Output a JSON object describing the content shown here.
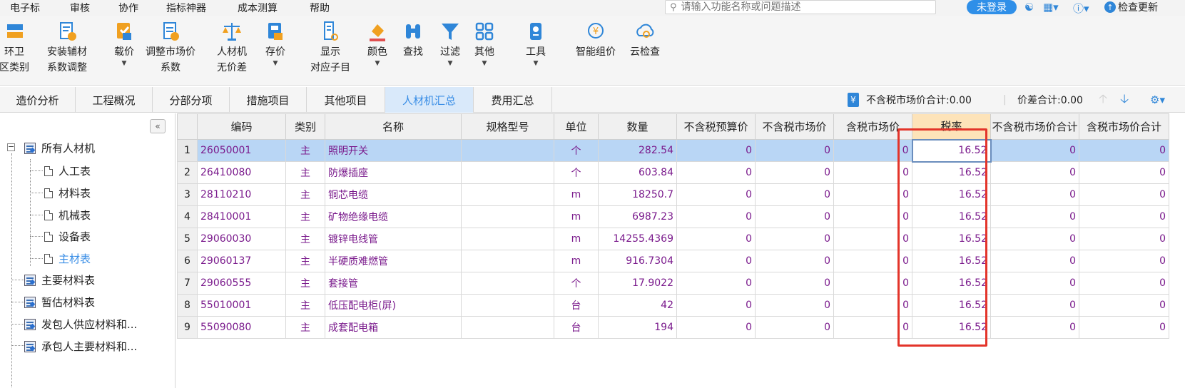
{
  "menu": [
    "电子标",
    "审核",
    "协作",
    "指标神器",
    "成本测算",
    "帮助"
  ],
  "search": {
    "placeholder": "请输入功能名称或问题描述"
  },
  "account": {
    "login_label": "未登录",
    "update_label": "检查更新"
  },
  "ribbon": [
    {
      "line1": "环卫",
      "line2": "区类别",
      "icon": "region-category-icon"
    },
    {
      "line1": "安装辅材",
      "line2": "系数调整",
      "icon": "material-coefficient-icon"
    },
    {
      "line1": "载价",
      "line2": "",
      "icon": "load-price-icon"
    },
    {
      "line1": "调整市场价",
      "line2": "系数",
      "icon": "adjust-market-price-icon"
    },
    {
      "line1": "人材机",
      "line2": "无价差",
      "icon": "balance-icon"
    },
    {
      "line1": "存价",
      "line2": "",
      "icon": "save-price-icon"
    },
    {
      "line1": "显示",
      "line2": "对应子目",
      "icon": "show-subitem-icon"
    },
    {
      "line1": "颜色",
      "line2": "",
      "icon": "color-bucket-icon"
    },
    {
      "line1": "查找",
      "line2": "",
      "icon": "binoculars-icon"
    },
    {
      "line1": "过滤",
      "line2": "",
      "icon": "filter-icon"
    },
    {
      "line1": "其他",
      "line2": "",
      "icon": "grid-more-icon"
    },
    {
      "line1": "工具",
      "line2": "",
      "icon": "tools-icon"
    },
    {
      "line1": "智能组价",
      "line2": "",
      "icon": "smart-pricing-icon"
    },
    {
      "line1": "云检查",
      "line2": "",
      "icon": "cloud-check-icon"
    }
  ],
  "tabs": [
    "造价分析",
    "工程概况",
    "分部分项",
    "措施项目",
    "其他项目",
    "人材机汇总",
    "费用汇总"
  ],
  "active_tab": "人材机汇总",
  "summary": {
    "market_total": "不含税市场价合计:0.00",
    "diff_total": "价差合计:0.00"
  },
  "tree": {
    "root": "所有人材机",
    "children": [
      "人工表",
      "材料表",
      "机械表",
      "设备表",
      "主材表"
    ],
    "selected": "主材表",
    "others": [
      "主要材料表",
      "暂估材料表",
      "发包人供应材料和...",
      "承包人主要材料和..."
    ]
  },
  "grid": {
    "headers": [
      "编码",
      "类别",
      "名称",
      "规格型号",
      "单位",
      "数量",
      "不含税预算价",
      "不含税市场价",
      "含税市场价",
      "税率",
      "不含税市场价合计",
      "含税市场价合计"
    ],
    "rows": [
      {
        "no": "1",
        "code": "26050001",
        "type": "主",
        "name": "照明开关",
        "spec": "",
        "unit": "个",
        "qty": "282.54",
        "p1": "0",
        "p2": "0",
        "p3": "0",
        "tax": "16.52",
        "t1": "0",
        "t2": "0"
      },
      {
        "no": "2",
        "code": "26410080",
        "type": "主",
        "name": "防爆插座",
        "spec": "",
        "unit": "个",
        "qty": "603.84",
        "p1": "0",
        "p2": "0",
        "p3": "0",
        "tax": "16.52",
        "t1": "0",
        "t2": "0"
      },
      {
        "no": "3",
        "code": "28110210",
        "type": "主",
        "name": "铜芯电缆",
        "spec": "",
        "unit": "m",
        "qty": "18250.7",
        "p1": "0",
        "p2": "0",
        "p3": "0",
        "tax": "16.52",
        "t1": "0",
        "t2": "0"
      },
      {
        "no": "4",
        "code": "28410001",
        "type": "主",
        "name": "矿物绝缘电缆",
        "spec": "",
        "unit": "m",
        "qty": "6987.23",
        "p1": "0",
        "p2": "0",
        "p3": "0",
        "tax": "16.52",
        "t1": "0",
        "t2": "0"
      },
      {
        "no": "5",
        "code": "29060030",
        "type": "主",
        "name": "镀锌电线管",
        "spec": "",
        "unit": "m",
        "qty": "14255.4369",
        "p1": "0",
        "p2": "0",
        "p3": "0",
        "tax": "16.52",
        "t1": "0",
        "t2": "0"
      },
      {
        "no": "6",
        "code": "29060137",
        "type": "主",
        "name": "半硬质难燃管",
        "spec": "",
        "unit": "m",
        "qty": "916.7304",
        "p1": "0",
        "p2": "0",
        "p3": "0",
        "tax": "16.52",
        "t1": "0",
        "t2": "0"
      },
      {
        "no": "7",
        "code": "29060555",
        "type": "主",
        "name": "套接管",
        "spec": "",
        "unit": "个",
        "qty": "17.9022",
        "p1": "0",
        "p2": "0",
        "p3": "0",
        "tax": "16.52",
        "t1": "0",
        "t2": "0"
      },
      {
        "no": "8",
        "code": "55010001",
        "type": "主",
        "name": "低压配电柜(屏)",
        "spec": "",
        "unit": "台",
        "qty": "42",
        "p1": "0",
        "p2": "0",
        "p3": "0",
        "tax": "16.52",
        "t1": "0",
        "t2": "0"
      },
      {
        "no": "9",
        "code": "55090080",
        "type": "主",
        "name": "成套配电箱",
        "spec": "",
        "unit": "台",
        "qty": "194",
        "p1": "0",
        "p2": "0",
        "p3": "0",
        "tax": "16.52",
        "t1": "0",
        "t2": "0"
      }
    ]
  },
  "colors": {
    "accent": "#3a8ee6",
    "row_text": "#7a1a8c",
    "selected_row": "#b9d6f5",
    "highlight_header": "#fde3b9",
    "annotation": "#e3342a"
  }
}
